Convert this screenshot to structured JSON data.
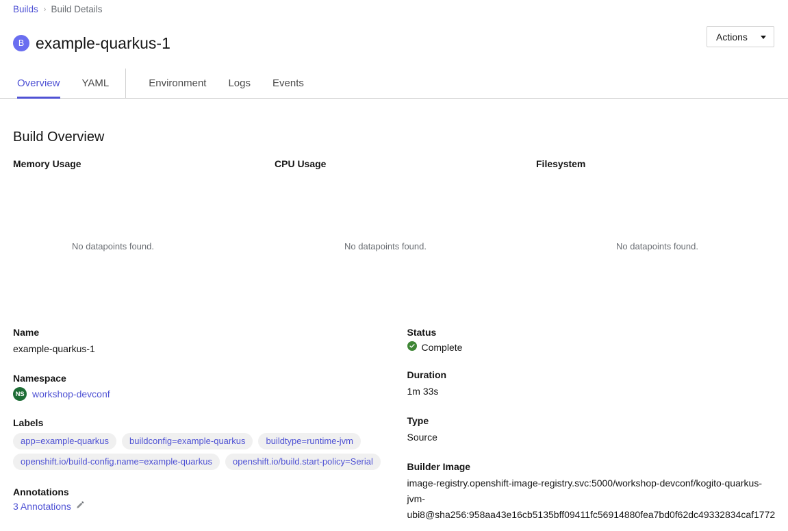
{
  "breadcrumb": {
    "parent": "Builds",
    "separator": "›",
    "current": "Build Details"
  },
  "header": {
    "badge_letter": "B",
    "title": "example-quarkus-1",
    "badge_color": "#6a6ef0",
    "actions_label": "Actions"
  },
  "tabs": [
    {
      "label": "Overview",
      "active": true
    },
    {
      "label": "YAML",
      "active": false
    },
    {
      "label": "Environment",
      "active": false
    },
    {
      "label": "Logs",
      "active": false
    },
    {
      "label": "Events",
      "active": false
    }
  ],
  "section": {
    "title": "Build Overview"
  },
  "metrics": [
    {
      "title": "Memory Usage",
      "empty_text": "No datapoints found."
    },
    {
      "title": "CPU Usage",
      "empty_text": "No datapoints found."
    },
    {
      "title": "Filesystem",
      "empty_text": "No datapoints found."
    }
  ],
  "details": {
    "left": {
      "name_label": "Name",
      "name_value": "example-quarkus-1",
      "namespace_label": "Namespace",
      "namespace_badge": "NS",
      "namespace_value": "workshop-devconf",
      "labels_label": "Labels",
      "labels": [
        "app=example-quarkus",
        "buildconfig=example-quarkus",
        "buildtype=runtime-jvm",
        "openshift.io/build-config.name=example-quarkus",
        "openshift.io/build.start-policy=Serial"
      ],
      "annotations_label": "Annotations",
      "annotations_value": "3 Annotations"
    },
    "right": {
      "status_label": "Status",
      "status_value": "Complete",
      "status_color": "#3e8635",
      "duration_label": "Duration",
      "duration_value": "1m 33s",
      "type_label": "Type",
      "type_value": "Source",
      "builder_image_label": "Builder Image",
      "builder_image_value": "image-registry.openshift-image-registry.svc:5000/workshop-devconf/kogito-quarkus-jvm-ubi8@sha256:958aa43e16cb5135bff09411fc56914880fea7bd0f62dc49332834caf1772"
    }
  },
  "theme": {
    "link_color": "#4f52d4",
    "text_color": "#151515",
    "muted_color": "#6a6e73",
    "border_color": "#d2d2d2",
    "chip_bg": "#f0f0f0",
    "namespace_badge_color": "#1e6d36"
  }
}
